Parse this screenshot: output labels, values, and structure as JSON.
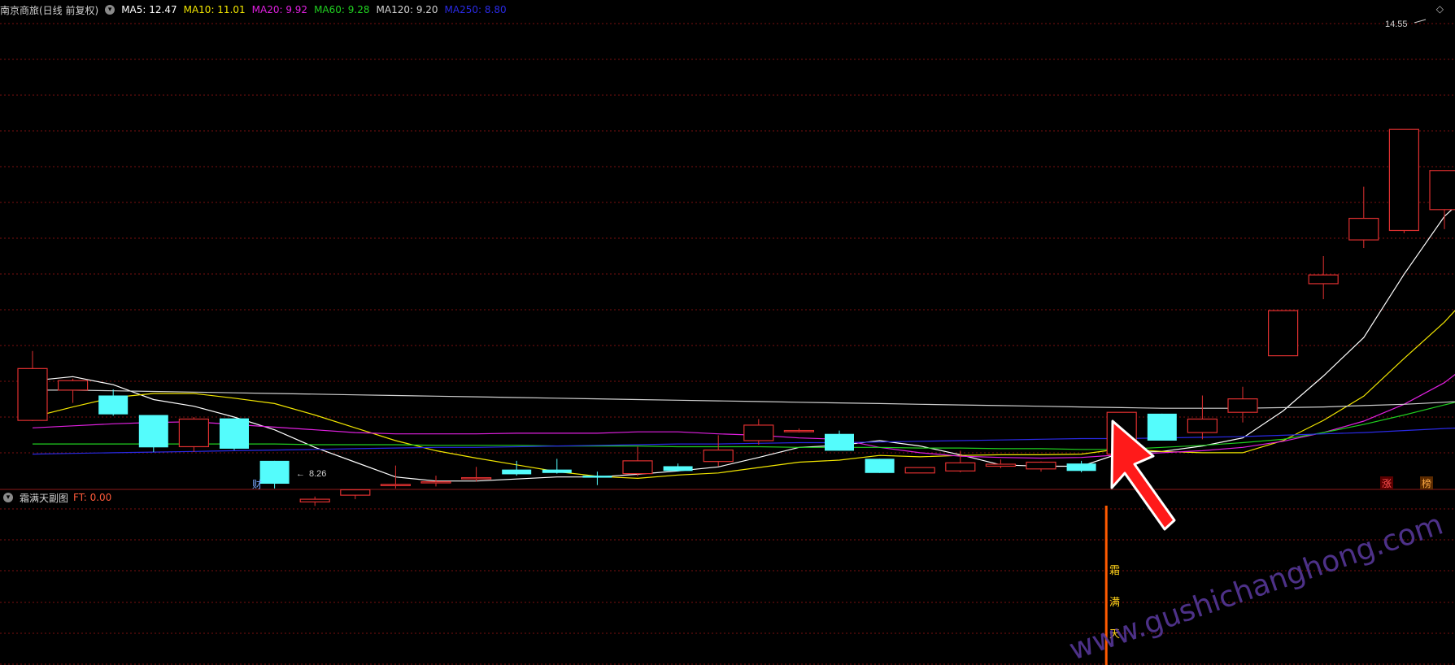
{
  "main_panel": {
    "stock_label": "南京商旅(日线 前复权)",
    "ma_legend": [
      {
        "name": "MA5",
        "label": "MA5: 12.47",
        "color": "#ffffff"
      },
      {
        "name": "MA10",
        "label": "MA10: 11.01",
        "color": "#f2e600"
      },
      {
        "name": "MA20",
        "label": "MA20: 9.92",
        "color": "#e020e0"
      },
      {
        "name": "MA60",
        "label": "MA60: 9.28",
        "color": "#20d020"
      },
      {
        "name": "MA120",
        "label": "MA120: 9.20",
        "color": "#d0d0d0"
      },
      {
        "name": "MA250",
        "label": "MA250: 8.80",
        "color": "#2a2ae6"
      }
    ],
    "high_label": "14.55",
    "low_label": "8.26",
    "markers": {
      "cai": "财",
      "zhang": "涨",
      "bang": "榜"
    }
  },
  "sub_panel": {
    "title": "霜满天副图",
    "ft_label": "FT: 0.00",
    "signal_chars": [
      "霜",
      "满",
      "天"
    ]
  },
  "colors": {
    "up": "#e03030",
    "down": "#54fcfc",
    "grid": "#7a1010",
    "signal": "#ff5a00",
    "arrow": "#ff1a1a",
    "watermark": "#5a3aa0"
  },
  "watermark": "www.gushichanghong.com",
  "chart_data": {
    "type": "candlestick",
    "y_price_range": [
      7.9,
      14.9
    ],
    "candles": [
      {
        "o": 8.9,
        "h": 9.93,
        "l": 8.89,
        "c": 9.67
      },
      {
        "o": 9.35,
        "h": 9.52,
        "l": 9.16,
        "c": 9.49
      },
      {
        "o": 9.27,
        "h": 9.36,
        "l": 8.97,
        "c": 8.99
      },
      {
        "o": 8.98,
        "h": 8.98,
        "l": 8.43,
        "c": 8.5
      },
      {
        "o": 8.51,
        "h": 8.95,
        "l": 8.43,
        "c": 8.92
      },
      {
        "o": 8.93,
        "h": 8.93,
        "l": 8.46,
        "c": 8.48
      },
      {
        "o": 8.3,
        "h": 8.3,
        "l": 7.89,
        "c": 7.96
      },
      {
        "o": 7.69,
        "h": 7.77,
        "l": 7.63,
        "c": 7.73
      },
      {
        "o": 7.79,
        "h": 7.87,
        "l": 7.73,
        "c": 7.87
      },
      {
        "o": 7.95,
        "h": 8.23,
        "l": 7.89,
        "c": 7.95
      },
      {
        "o": 7.99,
        "h": 8.08,
        "l": 7.92,
        "c": 7.99
      },
      {
        "o": 8.05,
        "h": 8.21,
        "l": 7.99,
        "c": 8.05
      },
      {
        "o": 8.17,
        "h": 8.3,
        "l": 8.08,
        "c": 8.1
      },
      {
        "o": 8.17,
        "h": 8.33,
        "l": 8.11,
        "c": 8.12
      },
      {
        "o": 8.08,
        "h": 8.14,
        "l": 7.94,
        "c": 8.05
      },
      {
        "o": 8.11,
        "h": 8.51,
        "l": 8.07,
        "c": 8.3
      },
      {
        "o": 8.22,
        "h": 8.26,
        "l": 8.14,
        "c": 8.15
      },
      {
        "o": 8.29,
        "h": 8.68,
        "l": 8.22,
        "c": 8.46
      },
      {
        "o": 8.6,
        "h": 8.92,
        "l": 8.54,
        "c": 8.83
      },
      {
        "o": 8.75,
        "h": 8.78,
        "l": 8.72,
        "c": 8.75
      },
      {
        "o": 8.7,
        "h": 8.75,
        "l": 8.45,
        "c": 8.45
      },
      {
        "o": 8.33,
        "h": 8.33,
        "l": 8.12,
        "c": 8.12
      },
      {
        "o": 8.12,
        "h": 8.2,
        "l": 8.12,
        "c": 8.2
      },
      {
        "o": 8.15,
        "h": 8.45,
        "l": 8.13,
        "c": 8.27
      },
      {
        "o": 8.22,
        "h": 8.32,
        "l": 8.19,
        "c": 8.25
      },
      {
        "o": 8.18,
        "h": 8.29,
        "l": 8.14,
        "c": 8.28
      },
      {
        "o": 8.26,
        "h": 8.3,
        "l": 8.13,
        "c": 8.15
      },
      {
        "o": 8.4,
        "h": 9.02,
        "l": 8.4,
        "c": 9.02
      },
      {
        "o": 9.0,
        "h": 9.0,
        "l": 8.6,
        "c": 8.6
      },
      {
        "o": 8.72,
        "h": 9.27,
        "l": 8.62,
        "c": 8.92
      },
      {
        "o": 9.02,
        "h": 9.4,
        "l": 8.87,
        "c": 9.22
      },
      {
        "o": 9.86,
        "h": 10.53,
        "l": 9.86,
        "c": 10.53
      },
      {
        "o": 10.93,
        "h": 11.34,
        "l": 10.7,
        "c": 11.06
      },
      {
        "o": 11.58,
        "h": 12.37,
        "l": 11.46,
        "c": 11.9
      },
      {
        "o": 11.72,
        "h": 12.72,
        "l": 11.68,
        "c": 13.22
      },
      {
        "o": 12.03,
        "h": 12.5,
        "l": 11.74,
        "c": 12.61
      },
      {
        "o": 14.07,
        "h": 14.55,
        "l": 13.06,
        "c": 13.06
      }
    ],
    "series": [
      {
        "name": "MA5",
        "values": [
          9.49,
          9.55,
          9.43,
          9.21,
          9.11,
          8.95,
          8.76,
          8.5,
          8.28,
          8.06,
          8.0,
          8.0,
          8.03,
          8.06,
          8.06,
          8.1,
          8.15,
          8.21,
          8.35,
          8.5,
          8.53,
          8.6,
          8.52,
          8.39,
          8.24,
          8.22,
          8.22,
          8.42,
          8.44,
          8.52,
          8.64,
          9.04,
          9.56,
          10.13,
          11.07,
          11.93,
          12.47
        ]
      },
      {
        "name": "MA10",
        "values": [
          8.95,
          9.1,
          9.24,
          9.3,
          9.3,
          9.23,
          9.15,
          8.98,
          8.79,
          8.6,
          8.45,
          8.34,
          8.24,
          8.14,
          8.07,
          8.04,
          8.09,
          8.12,
          8.2,
          8.28,
          8.31,
          8.38,
          8.36,
          8.38,
          8.39,
          8.39,
          8.4,
          8.48,
          8.44,
          8.42,
          8.42,
          8.6,
          8.9,
          9.26,
          9.82,
          10.36,
          11.01
        ]
      },
      {
        "name": "MA20",
        "values": [
          8.79,
          8.82,
          8.85,
          8.87,
          8.88,
          8.84,
          8.8,
          8.76,
          8.72,
          8.7,
          8.7,
          8.7,
          8.71,
          8.71,
          8.71,
          8.73,
          8.73,
          8.7,
          8.68,
          8.64,
          8.62,
          8.5,
          8.42,
          8.37,
          8.35,
          8.34,
          8.35,
          8.39,
          8.42,
          8.45,
          8.5,
          8.59,
          8.72,
          8.89,
          9.14,
          9.46,
          9.92
        ]
      },
      {
        "name": "MA60",
        "values": [
          8.55,
          8.55,
          8.55,
          8.55,
          8.55,
          8.55,
          8.55,
          8.54,
          8.54,
          8.54,
          8.53,
          8.53,
          8.53,
          8.52,
          8.52,
          8.52,
          8.51,
          8.51,
          8.51,
          8.5,
          8.5,
          8.5,
          8.49,
          8.49,
          8.48,
          8.48,
          8.47,
          8.47,
          8.5,
          8.53,
          8.57,
          8.62,
          8.72,
          8.84,
          8.98,
          9.13,
          9.28
        ]
      },
      {
        "name": "MA120",
        "values": [
          9.35,
          9.35,
          9.34,
          9.33,
          9.32,
          9.31,
          9.3,
          9.29,
          9.28,
          9.27,
          9.26,
          9.25,
          9.24,
          9.23,
          9.22,
          9.21,
          9.2,
          9.19,
          9.18,
          9.17,
          9.16,
          9.15,
          9.14,
          9.13,
          9.12,
          9.11,
          9.1,
          9.09,
          9.08,
          9.08,
          9.08,
          9.09,
          9.1,
          9.12,
          9.14,
          9.17,
          9.2
        ]
      },
      {
        "name": "MA250",
        "values": [
          8.4,
          8.41,
          8.42,
          8.43,
          8.44,
          8.45,
          8.46,
          8.47,
          8.48,
          8.49,
          8.5,
          8.5,
          8.51,
          8.52,
          8.53,
          8.54,
          8.55,
          8.55,
          8.56,
          8.57,
          8.57,
          8.58,
          8.59,
          8.6,
          8.61,
          8.62,
          8.63,
          8.63,
          8.64,
          8.65,
          8.66,
          8.68,
          8.7,
          8.72,
          8.75,
          8.78,
          8.8
        ]
      }
    ],
    "signal_bar_index": 27
  }
}
